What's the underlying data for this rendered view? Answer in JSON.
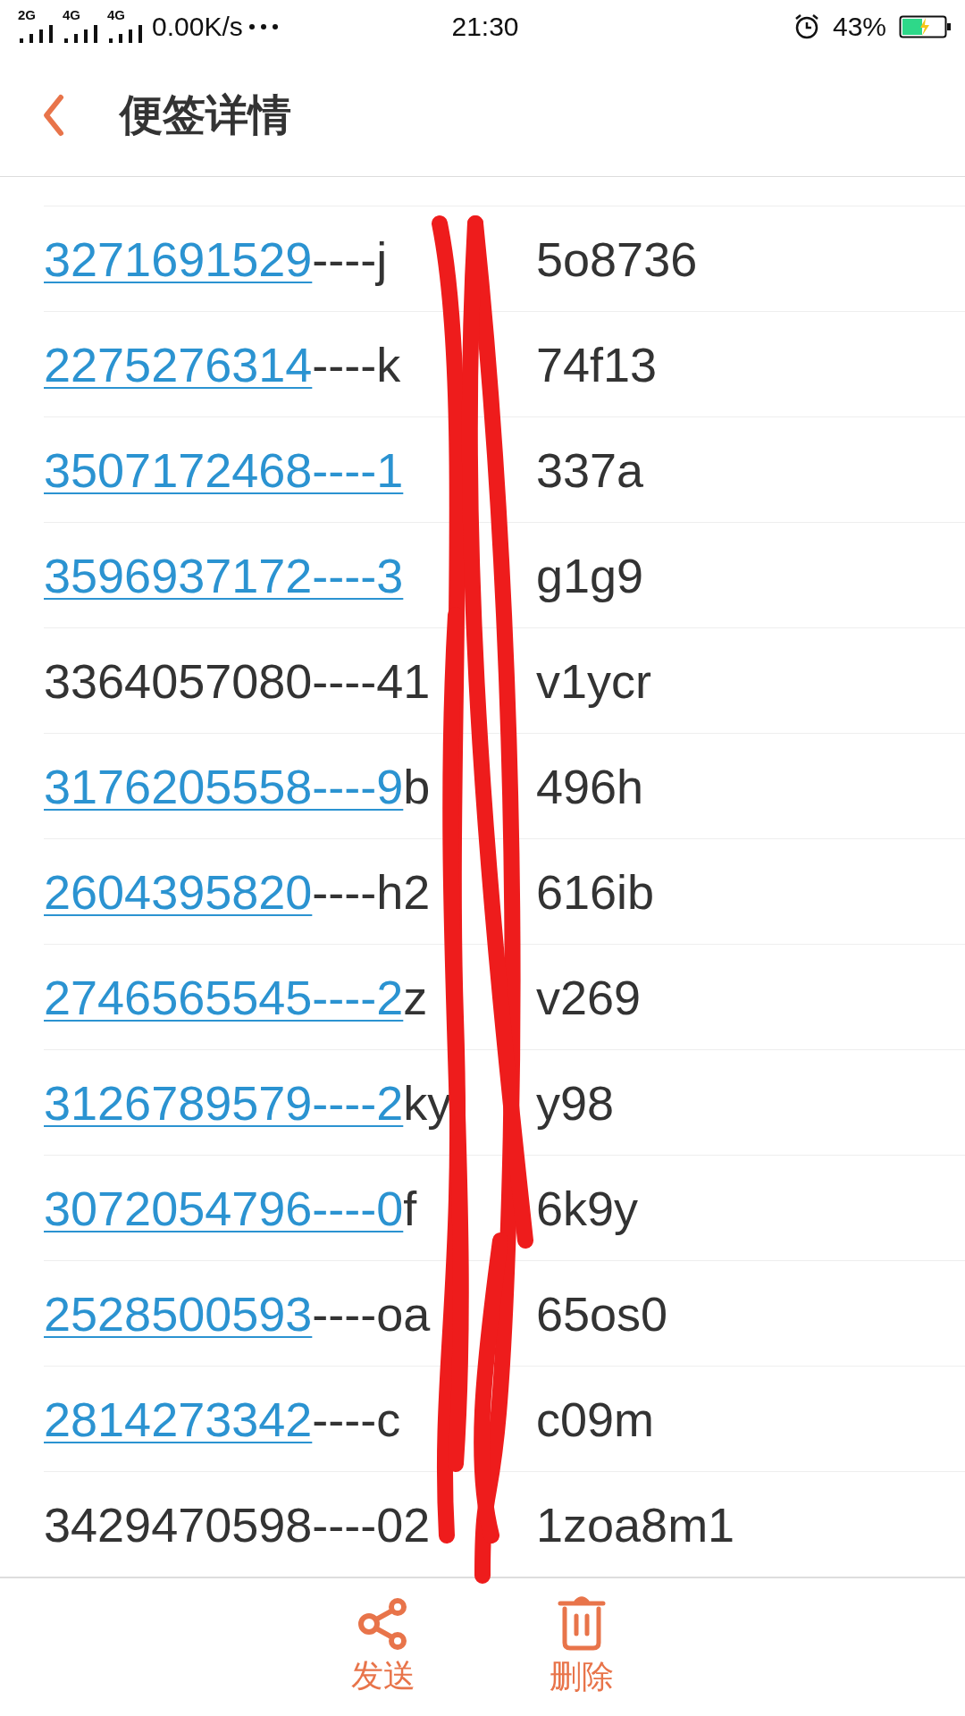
{
  "status_bar": {
    "signals": [
      {
        "label": "2G"
      },
      {
        "label": "4G"
      },
      {
        "label": "4G"
      }
    ],
    "speed": "0.00K/s",
    "time": "21:30",
    "battery": "43%"
  },
  "header": {
    "title": "便签详情"
  },
  "rows": [
    {
      "link": "3271691529",
      "text": "----j",
      "after": "5o8736"
    },
    {
      "link": "2275276314",
      "text": "----k",
      "after": "74f13"
    },
    {
      "link": "3507172468----1",
      "after": "337a"
    },
    {
      "link": "3596937172----3",
      "after": "g1g9"
    },
    {
      "text": "3364057080----41",
      "after": "v1ycr"
    },
    {
      "link": "3176205558----9",
      "text": "b",
      "after": "496h"
    },
    {
      "link": "2604395820",
      "text": "----h2",
      "after": "616ib"
    },
    {
      "link": "2746565545----2",
      "text": "z",
      "after": "v269"
    },
    {
      "link": "3126789579----2",
      "text": "ky",
      "after": "y98"
    },
    {
      "link": "3072054796----0",
      "text": "f",
      "after": "6k9y"
    },
    {
      "link": "2528500593",
      "text": "----oa",
      "after": "65os0"
    },
    {
      "link": "2814273342",
      "text": "----c",
      "after": "c09m"
    },
    {
      "text": "3429470598----02",
      "after": "1zoa8m1"
    }
  ],
  "actions": [
    {
      "kind": "share",
      "label": "发送"
    },
    {
      "kind": "delete",
      "label": "删除"
    }
  ]
}
